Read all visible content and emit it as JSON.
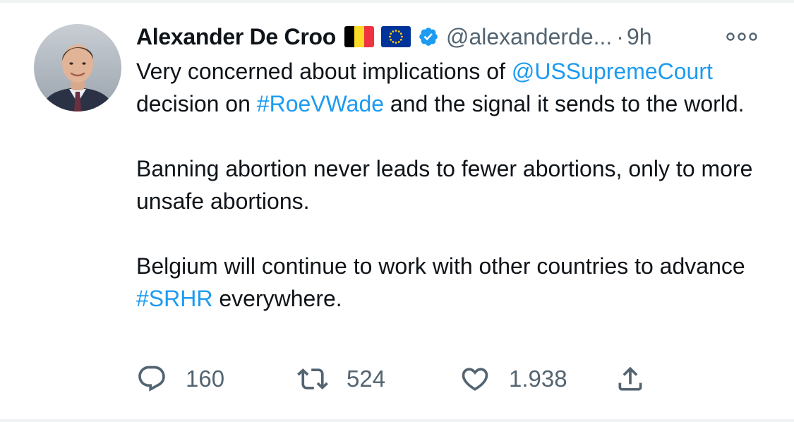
{
  "tweet": {
    "author": {
      "name": "Alexander De Croo",
      "handle": "@alexanderde...",
      "flags": [
        "belgium-flag-icon",
        "eu-flag-icon"
      ],
      "verified": true
    },
    "separator": "·",
    "time": "9h",
    "body": {
      "p1": {
        "t1": "Very concerned about implications of ",
        "mention": "@USSupremeCourt",
        "t2": " decision on ",
        "hashtag": "#RoeVWade",
        "t3": " and the signal it sends to the world."
      },
      "p2": "Banning abortion never leads to fewer abortions, only to more unsafe abortions.",
      "p3": {
        "t1": "Belgium will continue to work with other countries to advance ",
        "hashtag": "#SRHR",
        "t2": " everywhere."
      }
    },
    "actions": {
      "replies": "160",
      "retweets": "524",
      "likes": "1.938"
    }
  },
  "colors": {
    "link": "#1d9bf0",
    "secondary_text": "#536471",
    "primary_text": "#0f1419",
    "verified": "#1d9bf0",
    "belgium_flag": [
      "#000000",
      "#fdda24",
      "#ef3340"
    ],
    "eu_flag": [
      "#003399",
      "#ffcc00"
    ]
  },
  "icons": {
    "more": "more-horizontal-icon",
    "reply": "reply-icon",
    "retweet": "retweet-icon",
    "like": "heart-icon",
    "share": "share-icon",
    "verified": "verified-badge-icon"
  }
}
